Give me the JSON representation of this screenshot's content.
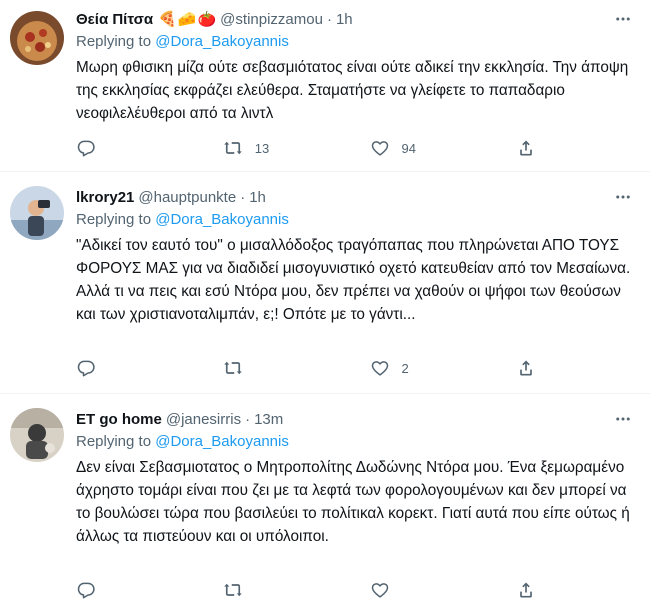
{
  "tweets": [
    {
      "name": "Θεία Πίτσα",
      "emoji": [
        "🍕",
        "🧀",
        "🍅"
      ],
      "handle": "@stinpizzamou",
      "time": "1h",
      "replying_prefix": "Replying to",
      "replying_to": "@Dora_Bakoyannis",
      "text": "Μωρη φθισικη μίζα ούτε σεβασμιότατος είναι ούτε αδικεί την εκκλησία. Την άποψη της εκκλησίας εκφράζει ελεύθερα. Σταματήστε να γλείφετε το παπαδαριο νεοφιλελέυθεροι από τα λιντλ",
      "retweets": "13",
      "likes": "94"
    },
    {
      "name": "lkrory21",
      "handle": "@hauptpunkte",
      "time": "1h",
      "replying_prefix": "Replying to",
      "replying_to": "@Dora_Bakoyannis",
      "text": "\"Αδικεί τον εαυτό του\" ο μισαλλόδοξος τραγόπαπας που πληρώνεται ΑΠΟ ΤΟΥΣ ΦΟΡΟΥΣ ΜΑΣ για να διαδιδεί μισογυνιστικό οχετό κατευθείαν από τον Μεσαίωνα. Αλλά τι να πεις και εσύ Ντόρα μου, δεν πρέπει να χαθούν οι ψήφοι των θεούσων και των χριστιανοταλιμπάν, ε;! Οπότε με το γάντι...",
      "retweets": "",
      "likes": "2"
    },
    {
      "name": "ET go home",
      "handle": "@janesirris",
      "time": "13m",
      "replying_prefix": "Replying to",
      "replying_to": "@Dora_Bakoyannis",
      "text": "Δεν είναι Σεβασμιοτατος ο Μητροπολίτης Δωδώνης Ντόρα μου. Ένα ξεμωραμένο άχρηστο τομάρι είναι που ζει με τα λεφτά των φορολογουμένων και δεν μπορεί να το βουλώσει τώρα που βασιλεύει το πολίτικαλ κορεκτ. Γιατί αυτά που είπε ούτως ή άλλως τα πιστεύουν και οι υπόλοιποι.",
      "retweets": "",
      "likes": ""
    }
  ],
  "colors": {
    "text": "#0f1419",
    "secondary": "#536471",
    "link": "#1d9bf0",
    "divider": "#eff3f4"
  },
  "icons": [
    "more-icon",
    "reply-icon",
    "retweet-icon",
    "like-icon",
    "share-icon"
  ]
}
